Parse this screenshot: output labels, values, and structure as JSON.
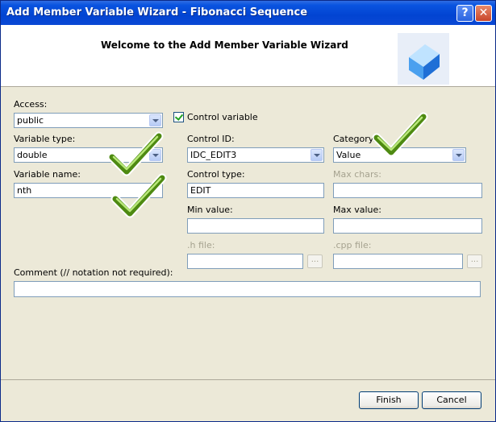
{
  "window": {
    "title": "Add Member Variable Wizard - Fibonacci Sequence",
    "help_glyph": "?",
    "close_glyph": "✕"
  },
  "header": {
    "welcome": "Welcome to the Add Member Variable Wizard",
    "icon": "cube-icon"
  },
  "form": {
    "access_label": "Access:",
    "access_value": "public",
    "variable_type_label": "Variable type:",
    "variable_type_value": "double",
    "variable_name_label": "Variable name:",
    "variable_name_value": "nth",
    "control_variable_label": "Control variable",
    "control_variable_checked": true,
    "control_id_label": "Control ID:",
    "control_id_value": "IDC_EDIT3",
    "control_type_label": "Control type:",
    "control_type_value": "EDIT",
    "min_value_label": "Min value:",
    "min_value_value": "",
    "h_file_label": ".h file:",
    "h_file_value": "",
    "category_label": "Category:",
    "category_value": "Value",
    "max_chars_label": "Max chars:",
    "max_chars_value": "",
    "max_value_label": "Max value:",
    "max_value_value": "",
    "cpp_file_label": ".cpp file:",
    "cpp_file_value": "",
    "browse_glyph": "...",
    "comment_label": "Comment (// notation not required):",
    "comment_value": ""
  },
  "buttons": {
    "finish": "Finish",
    "cancel": "Cancel"
  },
  "overlay_icons": [
    "checkmark-icon",
    "checkmark-icon",
    "checkmark-icon"
  ],
  "colors": {
    "title_bar": "#0244d2",
    "checkmark": "#4e8a12",
    "dialog_bg": "#ece9d8"
  }
}
